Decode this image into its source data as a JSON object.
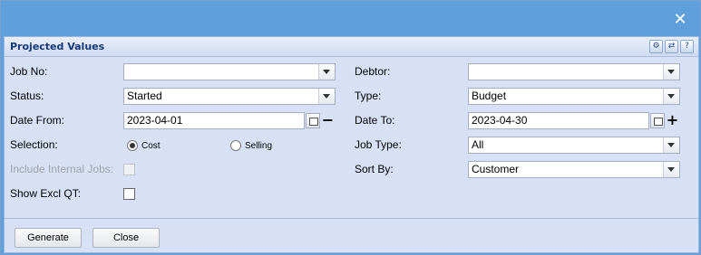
{
  "dialog": {
    "close_symbol": "✕"
  },
  "panel": {
    "title": "Projected Values"
  },
  "tools": [
    {
      "name": "settings-icon",
      "glyph": "⚙"
    },
    {
      "name": "refresh-icon",
      "glyph": "⇄"
    },
    {
      "name": "help-icon",
      "glyph": "?"
    }
  ],
  "form": {
    "job_no": {
      "label": "Job No:",
      "value": ""
    },
    "debtor": {
      "label": "Debtor:",
      "value": ""
    },
    "status": {
      "label": "Status:",
      "value": "Started"
    },
    "type": {
      "label": "Type:",
      "value": "Budget"
    },
    "date_from": {
      "label": "Date From:",
      "value": "2023-04-01",
      "action": "−"
    },
    "date_to": {
      "label": "Date To:",
      "value": "2023-04-30",
      "action": "+"
    },
    "selection": {
      "label": "Selection:",
      "options": [
        "Cost",
        "Selling"
      ],
      "selected": "Cost"
    },
    "job_type": {
      "label": "Job Type:",
      "value": "All"
    },
    "include_internal": {
      "label": "Include Internal Jobs:",
      "checked": false,
      "disabled": true
    },
    "sort_by": {
      "label": "Sort By:",
      "value": "Customer"
    },
    "show_excl_qt": {
      "label": "Show Excl QT:",
      "checked": false
    }
  },
  "buttons": {
    "generate": "Generate",
    "close": "Close"
  }
}
